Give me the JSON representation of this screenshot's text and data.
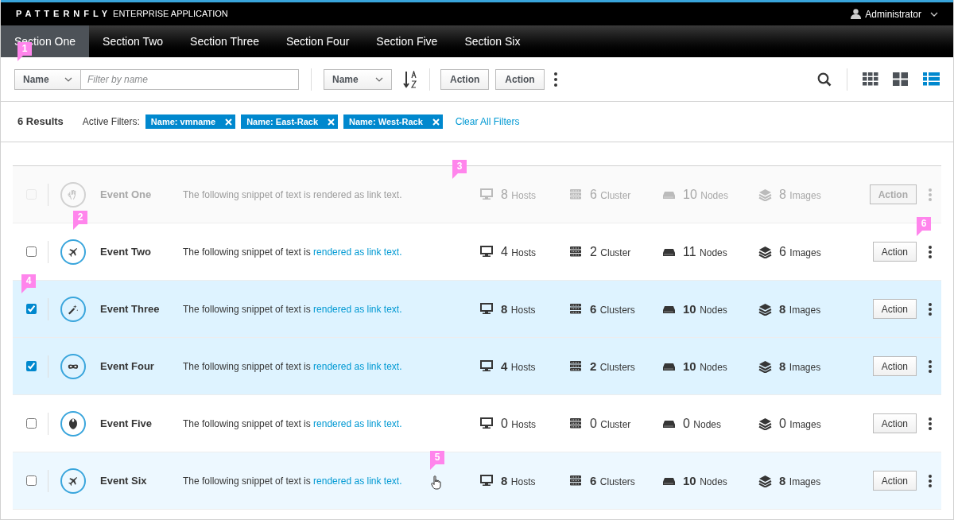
{
  "masthead": {
    "brand": "PATTERNFLY",
    "subtitle": "ENTERPRISE APPLICATION",
    "user": "Administrator"
  },
  "nav": [
    {
      "label": "Section One",
      "selected": true
    },
    {
      "label": "Section Two",
      "selected": false
    },
    {
      "label": "Section Three",
      "selected": false
    },
    {
      "label": "Section Four",
      "selected": false
    },
    {
      "label": "Section Five",
      "selected": false
    },
    {
      "label": "Section Six",
      "selected": false
    }
  ],
  "toolbar": {
    "filter_field": "Name",
    "filter_placeholder": "Filter by name",
    "sort_field": "Name",
    "actions": [
      "Action",
      "Action"
    ],
    "views": [
      {
        "selected": false
      },
      {
        "selected": false
      },
      {
        "selected": true
      }
    ]
  },
  "results": {
    "count": "6 Results",
    "active_filters_label": "Active Filters:",
    "filters": [
      "Name: vmname",
      "Name: East-Rack",
      "Name: West-Rack"
    ],
    "clear": "Clear All Filters"
  },
  "rows": [
    {
      "name": "Event One",
      "description": "The following snippet of text is ",
      "link": "rendered as link text.",
      "checked": false,
      "disabled": true,
      "selected": false,
      "hovered": false,
      "stats": [
        {
          "count": "8",
          "unit": "Hosts"
        },
        {
          "count": "6",
          "unit": "Cluster"
        },
        {
          "count": "10",
          "unit": "Nodes"
        },
        {
          "count": "8",
          "unit": "Images"
        }
      ],
      "action": "Action"
    },
    {
      "name": "Event Two",
      "description": "The following snippet of text is ",
      "link": "rendered as link text.",
      "checked": false,
      "disabled": false,
      "selected": false,
      "hovered": false,
      "stats": [
        {
          "count": "4",
          "unit": "Hosts"
        },
        {
          "count": "2",
          "unit": "Cluster"
        },
        {
          "count": "11",
          "unit": "Nodes"
        },
        {
          "count": "6",
          "unit": "Images"
        }
      ],
      "action": "Action"
    },
    {
      "name": "Event Three",
      "description": "The following snippet of text is ",
      "link": "rendered as link text.",
      "checked": true,
      "disabled": false,
      "selected": true,
      "hovered": false,
      "stats": [
        {
          "count": "8",
          "unit": "Hosts"
        },
        {
          "count": "6",
          "unit": "Clusters"
        },
        {
          "count": "10",
          "unit": "Nodes"
        },
        {
          "count": "8",
          "unit": "Images"
        }
      ],
      "action": "Action"
    },
    {
      "name": "Event Four",
      "description": "The following snippet of text is ",
      "link": "rendered as link text.",
      "checked": true,
      "disabled": false,
      "selected": true,
      "hovered": false,
      "stats": [
        {
          "count": "4",
          "unit": "Hosts"
        },
        {
          "count": "2",
          "unit": "Clusters"
        },
        {
          "count": "10",
          "unit": "Nodes"
        },
        {
          "count": "8",
          "unit": "Images"
        }
      ],
      "action": "Action"
    },
    {
      "name": "Event Five",
      "description": "The following snippet of text is ",
      "link": "rendered as link text.",
      "checked": false,
      "disabled": false,
      "selected": false,
      "hovered": false,
      "stats": [
        {
          "count": "0",
          "unit": "Hosts"
        },
        {
          "count": "0",
          "unit": "Cluster"
        },
        {
          "count": "0",
          "unit": "Nodes"
        },
        {
          "count": "0",
          "unit": "Images"
        }
      ],
      "action": "Action"
    },
    {
      "name": "Event Six",
      "description": "The following snippet of text is ",
      "link": "rendered as link text.",
      "checked": false,
      "disabled": false,
      "selected": false,
      "hovered": true,
      "stats": [
        {
          "count": "8",
          "unit": "Hosts"
        },
        {
          "count": "6",
          "unit": "Clusters"
        },
        {
          "count": "10",
          "unit": "Nodes"
        },
        {
          "count": "8",
          "unit": "Images"
        }
      ],
      "action": "Action"
    }
  ],
  "callouts": [
    "1",
    "2",
    "3",
    "4",
    "5",
    "6"
  ]
}
